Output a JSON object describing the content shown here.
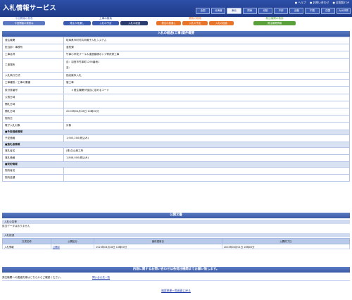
{
  "header": {
    "title": "入札情報サービス",
    "links": [
      "ヘルプ",
      "お問い合わせ",
      "全国版TOP"
    ],
    "regions": [
      "全国",
      "北海道",
      "東北",
      "関東",
      "北陸",
      "中部",
      "近畿",
      "中国",
      "四国",
      "九州沖縄"
    ],
    "region_active": 2
  },
  "nav": [
    {
      "label": "今回開催の発表",
      "buttons": [
        "今回開催の発表ね"
      ],
      "colors": [
        "#5c78c3"
      ]
    },
    {
      "label": "工事の検索",
      "buttons": [
        "発注の見通し",
        "入札の予定",
        "入札の経過"
      ],
      "colors": [
        "#3b5bb0",
        "#3b5bb0",
        "#2b3d6e"
      ]
    },
    {
      "label": "業務の検索",
      "buttons": [
        "発注の見通し",
        "入札の予定",
        "入札の経過"
      ],
      "colors": [
        "#e8742a",
        "#e8742a",
        "#e8742a"
      ]
    },
    {
      "label": "発注機関の検索",
      "buttons": [
        "発注機関情報"
      ],
      "colors": [
        "#5aa03b"
      ]
    }
  ],
  "main_title": "入札の経過(工事)案件概要",
  "rows": [
    {
      "k": "発注機関",
      "v": "岐阜県市町村共同電子入札システム"
    },
    {
      "k": "担当部・事務所",
      "v": "釜校課"
    },
    {
      "k": "工事名称",
      "v": "竹鼻小学校プール＆濾過循環ポンプ等改修工事"
    },
    {
      "k": "工事場所",
      "v": "自：羽島市竹鼻町1295番地1",
      "v2": "至：",
      "tall": true
    },
    {
      "k": "入札執行方式",
      "v": "指名競争入札"
    },
    {
      "k": "工事種別／工事の業種",
      "v": "管工事"
    },
    {
      "k": "設計書番号",
      "v": "　　＊発注機関が独自に定めるコード"
    },
    {
      "k": "公表日時",
      "v": ""
    },
    {
      "k": "開札日時",
      "v": ""
    },
    {
      "k": "開札日時",
      "v": "2023年04月18日 10時00分"
    },
    {
      "k": "契約日",
      "v": ""
    },
    {
      "k": "電子入札対象",
      "v": "対象"
    },
    {
      "sec": "■予定価格情報"
    },
    {
      "k": "予定価格",
      "v": "1,905,200(税込み)"
    },
    {
      "sec": "■落札者情報"
    },
    {
      "k": "落札者名",
      "v": "(株)久山商工所"
    },
    {
      "k": "落札価格",
      "v": "1,848,000(税込み)"
    },
    {
      "sec": "■契約情報"
    },
    {
      "k": "契約者名",
      "v": ""
    },
    {
      "k": "契約金額",
      "v": ""
    }
  ],
  "public_docs": {
    "title": "公開文書",
    "notice_label": "入札公告等",
    "notice_text": "該当データはありません",
    "results_label": "入札経過",
    "columns": [
      "文書名称",
      "公開区分",
      "最終更新日",
      "公開終了日"
    ],
    "row": [
      "入札情報",
      "公開中",
      "2023年04月18日 10時00分",
      "2023年04月01日 10時00分"
    ]
  },
  "inquiry": {
    "title": "内容に関するお問い合わせは各発注機関までお願い致します。",
    "text": "発注機関への連絡先等はこちらからご確認ください。",
    "link": "問い合せ先一覧"
  },
  "back_link": "検索結果一覧画面に戻る"
}
